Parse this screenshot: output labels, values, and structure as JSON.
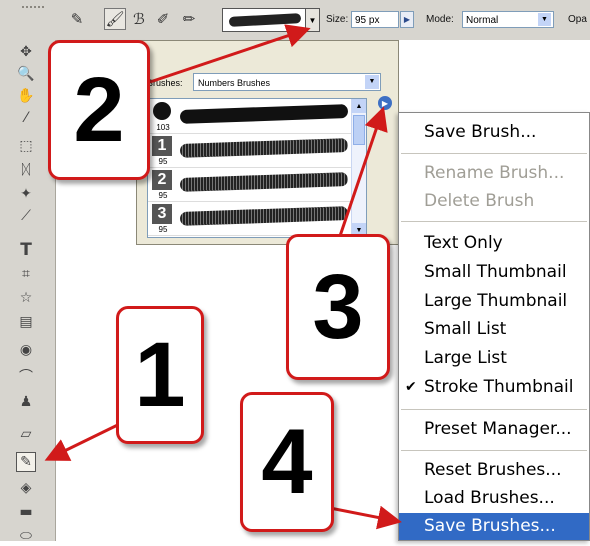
{
  "options_bar": {
    "size_label": "Size:",
    "size_value": "95 px",
    "mode_label": "Mode:",
    "mode_value": "Normal",
    "opacity_label_partial": "Opa"
  },
  "brush_popup": {
    "brushes_label": "Brushes:",
    "brush_set": "Numbers Brushes",
    "brushes": [
      {
        "number": "",
        "size": "103",
        "stroke": "solid"
      },
      {
        "number": "1",
        "size": "95",
        "stroke": "textured"
      },
      {
        "number": "2",
        "size": "95",
        "stroke": "textured"
      },
      {
        "number": "3",
        "size": "95",
        "stroke": "textured"
      }
    ]
  },
  "context_menu": {
    "groups": [
      [
        {
          "label": "Save Brush...",
          "disabled": false
        }
      ],
      [
        {
          "label": "Rename Brush...",
          "disabled": true
        },
        {
          "label": "Delete Brush",
          "disabled": true
        }
      ],
      [
        {
          "label": "Text Only",
          "disabled": false
        },
        {
          "label": "Small Thumbnail",
          "disabled": false
        },
        {
          "label": "Large Thumbnail",
          "disabled": false
        },
        {
          "label": "Small List",
          "disabled": false
        },
        {
          "label": "Large List",
          "disabled": false
        },
        {
          "label": "Stroke Thumbnail",
          "disabled": false,
          "checked": true
        }
      ],
      [
        {
          "label": "Preset Manager...",
          "disabled": false
        }
      ],
      [
        {
          "label": "Reset Brushes...",
          "disabled": false
        },
        {
          "label": "Load Brushes...",
          "disabled": false
        },
        {
          "label": "Save Brushes...",
          "disabled": false,
          "highlighted": true
        }
      ]
    ]
  },
  "callouts": [
    "1",
    "2",
    "3",
    "4"
  ],
  "colors": {
    "callout_border": "#d11a1a",
    "arrow": "#d11a1a",
    "menu_highlight": "#316ac5"
  }
}
